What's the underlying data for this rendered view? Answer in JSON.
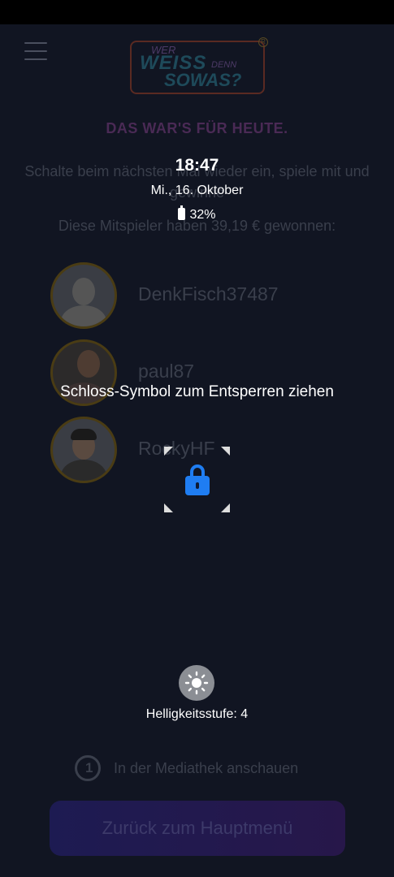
{
  "app": {
    "logo": {
      "line1": "WER",
      "line2": "WEISS",
      "line3": "DENN",
      "line4": "SOWAS?",
      "registered": "R"
    },
    "headline": "DAS WAR'S FÜR HEUTE.",
    "subtext": "Schalte beim nächsten Mal wieder ein, spiele mit und gewinne",
    "winners_text": "Diese Mitspieler haben 39,19 € gewonnen:",
    "players": [
      {
        "name": "DenkFisch37487"
      },
      {
        "name": "paul87"
      },
      {
        "name": "RockyHF"
      }
    ],
    "mediathek": {
      "icon_text": "1",
      "label": "In der Mediathek anschauen"
    },
    "back_button": "Zurück zum Hauptmenü"
  },
  "lockscreen": {
    "time": "18:47",
    "date": "Mi., 16. Oktober",
    "battery": "32%",
    "unlock_hint": "Schloss-Symbol zum Entsperren ziehen",
    "brightness_label": "Helligkeitsstufe: 4",
    "lock_icon": "padlock-icon",
    "accent_color": "#1f7df2"
  }
}
